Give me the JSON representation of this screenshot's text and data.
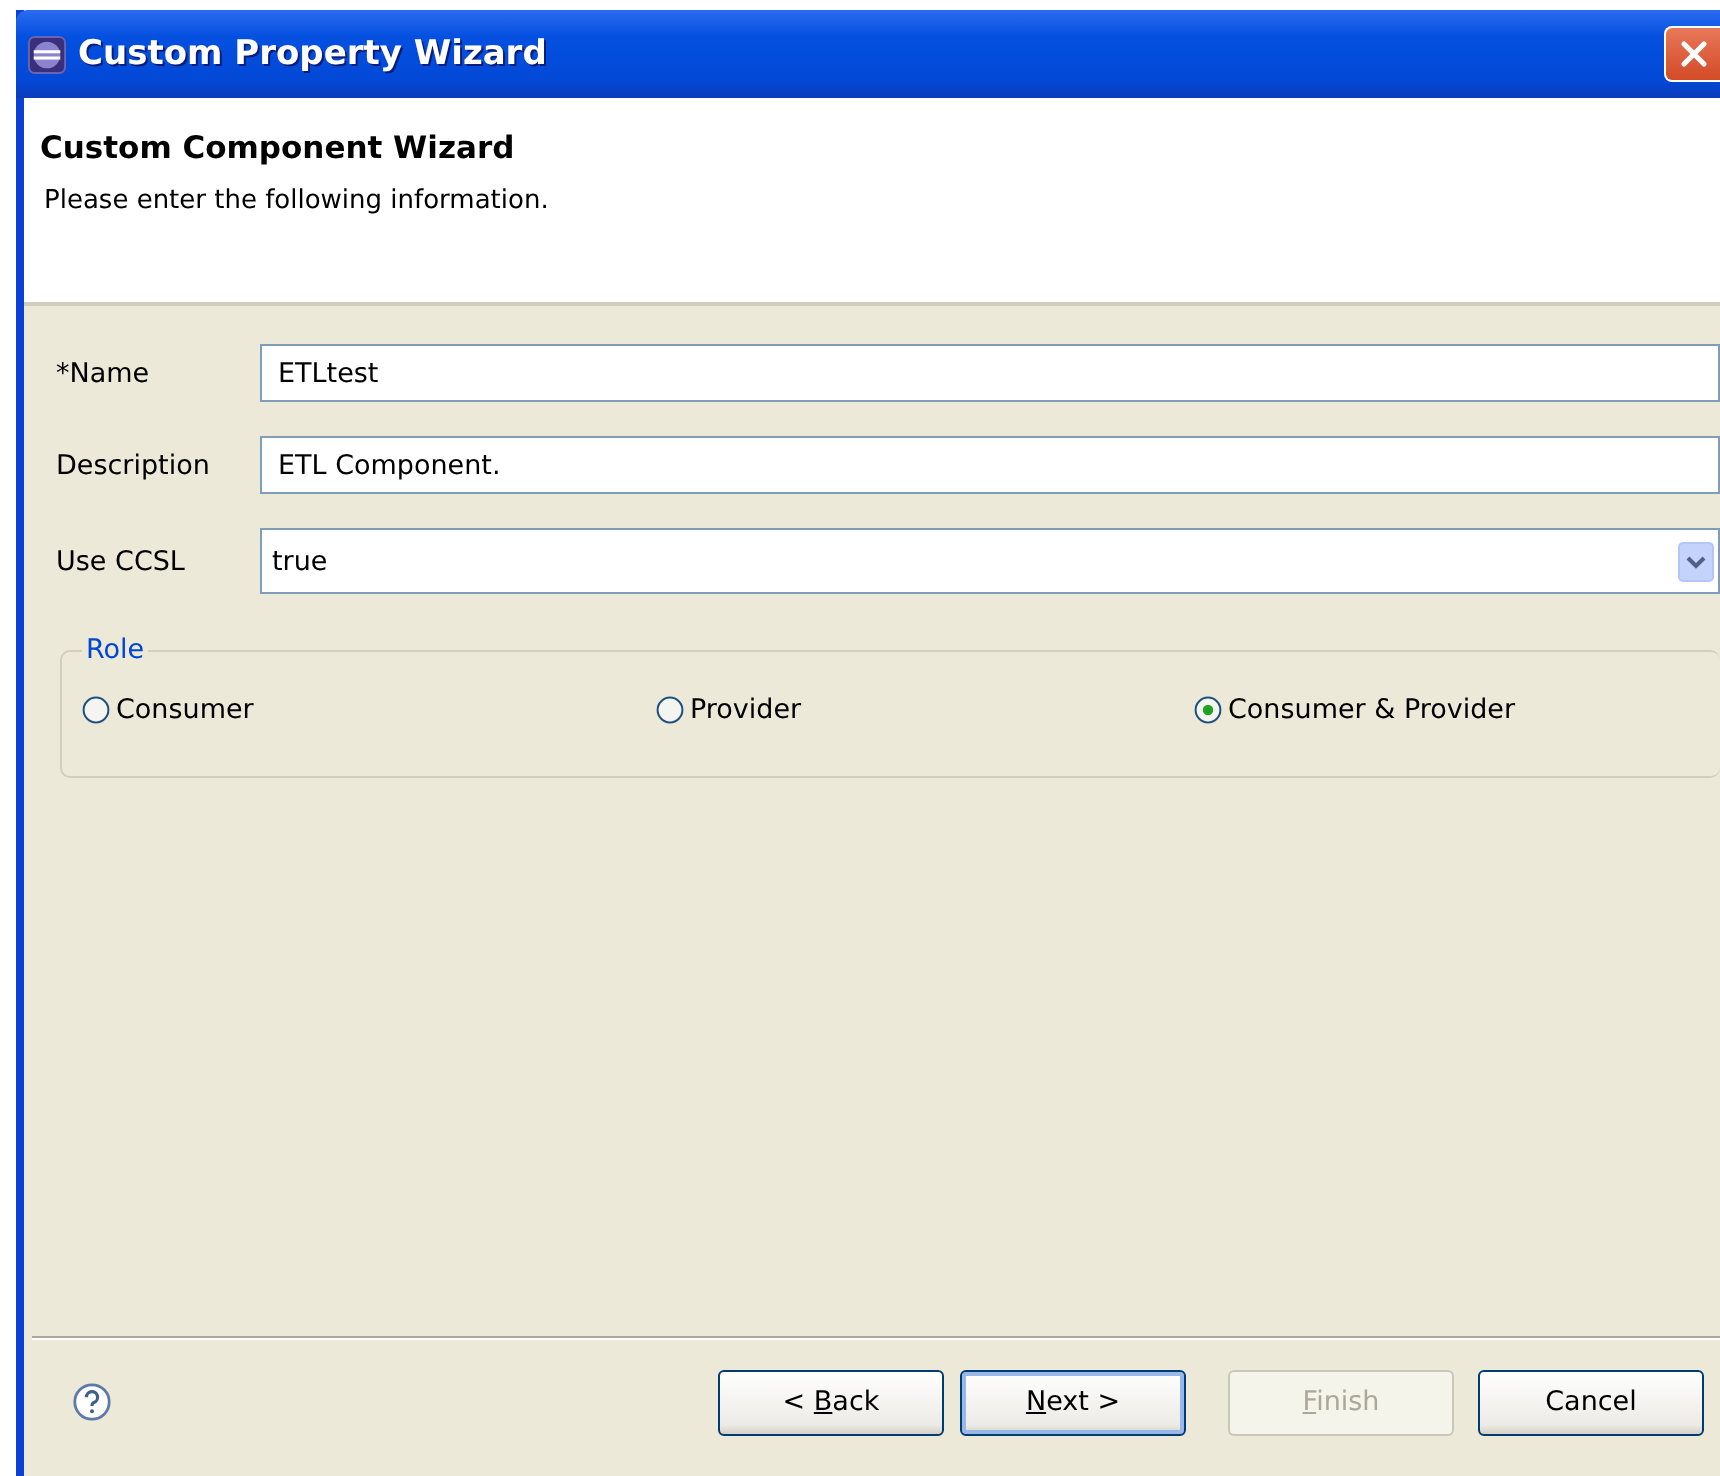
{
  "window": {
    "title": "Custom Property Wizard"
  },
  "header": {
    "title": "Custom Component Wizard",
    "message": "Please enter the following information."
  },
  "fields": [
    {
      "kind": "text",
      "label": "*Name",
      "value": "ETLtest"
    },
    {
      "kind": "text",
      "label": "Description",
      "value": "ETL Component."
    },
    {
      "kind": "dropdown",
      "label": "Use CCSL",
      "value": "true"
    }
  ],
  "role_group": {
    "title": "Role",
    "options": [
      {
        "label": "Consumer",
        "selected": false
      },
      {
        "label": "Provider",
        "selected": false
      },
      {
        "label": "Consumer & Provider",
        "selected": true
      }
    ]
  },
  "buttons": [
    {
      "label_parts": [
        {
          "text": "< ",
          "mnemonic": false
        },
        {
          "text": "B",
          "mnemonic": true
        },
        {
          "text": "ack",
          "mnemonic": false
        }
      ],
      "default": false,
      "disabled": false
    },
    {
      "label_parts": [
        {
          "text": "N",
          "mnemonic": true
        },
        {
          "text": "ext >",
          "mnemonic": false
        }
      ],
      "default": true,
      "disabled": false
    },
    {
      "label_parts": [
        {
          "text": "F",
          "mnemonic": true
        },
        {
          "text": "inish",
          "mnemonic": false
        }
      ],
      "default": false,
      "disabled": true
    },
    {
      "label_parts": [
        {
          "text": "Cancel",
          "mnemonic": false
        }
      ],
      "default": false,
      "disabled": false
    }
  ]
}
